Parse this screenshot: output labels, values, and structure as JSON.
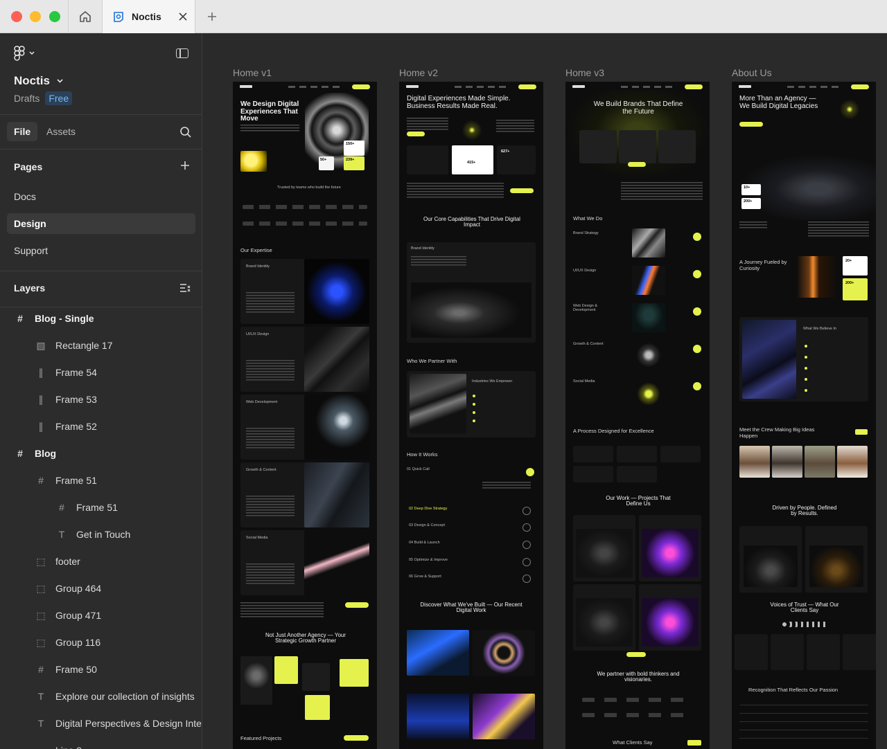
{
  "titlebar": {
    "tab_name": "Noctis"
  },
  "sidebar": {
    "project_name": "Noctis",
    "drafts_label": "Drafts",
    "plan_badge": "Free",
    "tab_file": "File",
    "tab_assets": "Assets",
    "pages_header": "Pages",
    "pages": [
      "Docs",
      "Design",
      "Support"
    ],
    "selected_page": "Design",
    "layers_header": "Layers",
    "layers": [
      {
        "name": "Blog - Single",
        "type": "frame",
        "indent": 0
      },
      {
        "name": "Rectangle 17",
        "type": "image",
        "indent": 1
      },
      {
        "name": "Frame 54",
        "type": "autolayout",
        "indent": 1
      },
      {
        "name": "Frame 53",
        "type": "autolayout",
        "indent": 1
      },
      {
        "name": "Frame 52",
        "type": "autolayout",
        "indent": 1
      },
      {
        "name": "Blog",
        "type": "frame",
        "indent": 0
      },
      {
        "name": "Frame 51",
        "type": "frame",
        "indent": 1
      },
      {
        "name": "Frame 51",
        "type": "frame",
        "indent": 2
      },
      {
        "name": "Get in Touch",
        "type": "text",
        "indent": 2
      },
      {
        "name": "footer",
        "type": "group",
        "indent": 1
      },
      {
        "name": "Group 464",
        "type": "group",
        "indent": 1
      },
      {
        "name": "Group 471",
        "type": "group",
        "indent": 1
      },
      {
        "name": "Group 116",
        "type": "group",
        "indent": 1
      },
      {
        "name": "Frame 50",
        "type": "frame",
        "indent": 1
      },
      {
        "name": "Explore our collection of insights",
        "type": "text",
        "indent": 1
      },
      {
        "name": "Digital Perspectives & Design Inte",
        "type": "text",
        "indent": 1
      },
      {
        "name": "Line 9",
        "type": "line",
        "indent": 1
      }
    ]
  },
  "canvas": {
    "frames": [
      {
        "label": "Home v1",
        "hero_title": "We Design Digital Experiences That Move",
        "stat1": "150+",
        "stat2": "50+",
        "stat3": "239+",
        "trusted": "Trusted by teams who build the future",
        "expertise_title": "Our Expertise",
        "services": [
          "Brand Identity",
          "UI/UX Design",
          "Web Development",
          "Growth & Content",
          "Social Media"
        ],
        "agency_title": "Not Just Another Agency — Your Strategic Growth Partner",
        "featured": "Featured Projects"
      },
      {
        "label": "Home v2",
        "hero_title": "Digital Experiences Made Simple. Business Results Made Real.",
        "stat1": "415+",
        "stat2": "627+",
        "capabilities_title": "Our Core Capabilities That Drive Digital Impact",
        "brand_identity": "Brand Identity",
        "partner_title": "Who We Partner With",
        "industries": "Industries We Empower",
        "how_title": "How It Works",
        "steps": [
          "01  Quick Call",
          "02  Deep Dive Strategy",
          "03  Design & Concept",
          "04  Build & Launch",
          "05  Optimize & Improve",
          "06  Grow & Support"
        ],
        "built_title": "Discover What We've Built — Our Recent Digital Work"
      },
      {
        "label": "Home v3",
        "hero_title": "We Build Brands That Define the Future",
        "whatwedo": "What We Do",
        "services": [
          "Brand Strategy",
          "UI/UX Design",
          "Web Design & Development",
          "Growth & Content",
          "Social Media"
        ],
        "process_title": "A Process Designed for Excellence",
        "projects_title": "Our Work — Projects That Define Us",
        "partner_title": "We partner with bold thinkers and visionaries.",
        "clients_title": "What Clients Say"
      },
      {
        "label": "About Us",
        "hero_title": "More Than an Agency — We Build Digital Legacies",
        "stat1": "10+",
        "stat2": "200+",
        "journey": "A Journey Fueled by Curiosity",
        "stat3": "20+",
        "stat4": "200+",
        "believe": "What We Believe In",
        "crew_title": "Meet the Crew Making Big Ideas Happen",
        "driven": "Driven by People. Defined by Results.",
        "voices": "Voices of Trust — What Our Clients Say",
        "recognition": "Recognition That Reflects Our Passion"
      }
    ]
  },
  "colors": {
    "accent": "#e5f24d",
    "canvas_bg": "#2a2a2a",
    "sidebar_bg": "#2c2c2c",
    "frame_bg": "#0d0d0d",
    "badge_bg": "#2a4159",
    "badge_text": "#7cb6f5"
  }
}
